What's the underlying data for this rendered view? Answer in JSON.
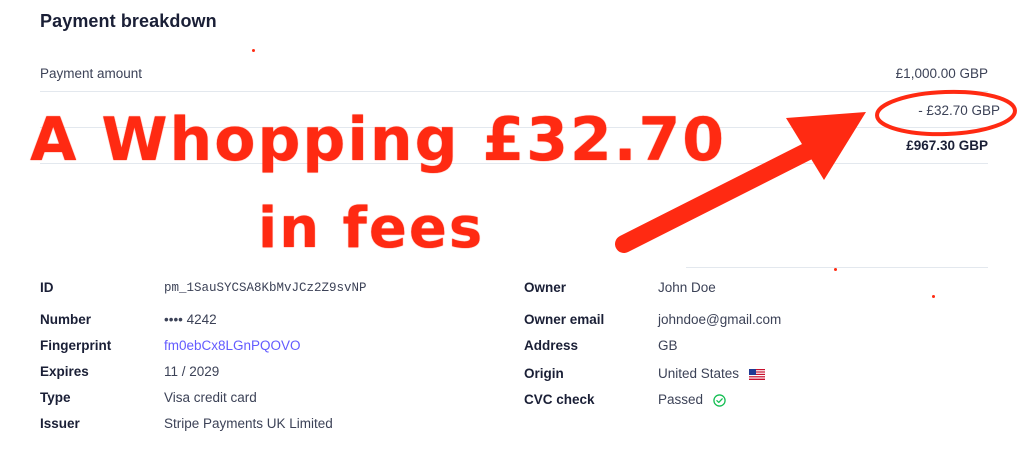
{
  "payment_breakdown": {
    "title": "Payment breakdown",
    "rows": [
      {
        "label": "Payment amount",
        "value": "£1,000.00 GBP"
      },
      {
        "label": "",
        "value": "- £32.70 GBP"
      },
      {
        "label": "",
        "value": "£967.30 GBP"
      }
    ]
  },
  "payment_method": {
    "left": [
      {
        "label": "ID",
        "value": "pm_1SauSYCSA8KbMvJCz2Z9svNP"
      },
      {
        "label": "Number",
        "value": "•••• 4242"
      },
      {
        "label": "Fingerprint",
        "value": "fm0ebCx8LGnPQOVO"
      },
      {
        "label": "Expires",
        "value": "11 / 2029"
      },
      {
        "label": "Type",
        "value": "Visa credit card"
      },
      {
        "label": "Issuer",
        "value": "Stripe Payments UK Limited"
      }
    ],
    "right": [
      {
        "label": "Owner",
        "value": "John Doe"
      },
      {
        "label": "Owner email",
        "value": "johndoe@gmail.com"
      },
      {
        "label": "Address",
        "value": "GB"
      },
      {
        "label": "Origin",
        "value": "United States",
        "icon": "us-flag-icon"
      },
      {
        "label": "CVC check",
        "value": "Passed",
        "icon": "check-circle-icon"
      }
    ]
  },
  "annotation": {
    "line1": "A Whopping £32.70",
    "line2": "in fees",
    "color": "#ff2a12"
  },
  "colors": {
    "link": "#635bff",
    "text": "#1a1f36",
    "muted": "#3c4257",
    "divider": "#e3e8ee",
    "check": "#15be53"
  }
}
